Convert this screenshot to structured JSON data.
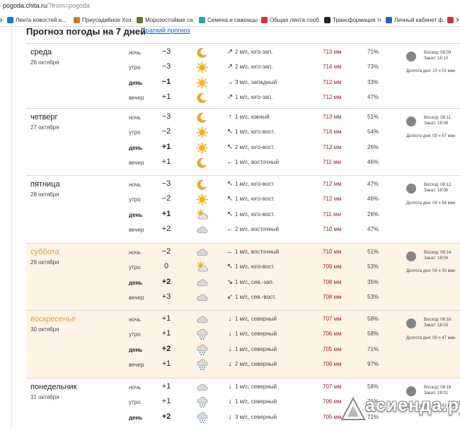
{
  "browser": {
    "url_host": "pogoda.chita.ru",
    "url_path": "/?from=pogoda"
  },
  "bookmarks": [
    {
      "label": "Лента новостей и...",
      "color": "#1a73e8"
    },
    {
      "label": "Приусадебное Хоз...",
      "color": "#c77a20"
    },
    {
      "label": "Морозостойкие са...",
      "color": "#5a7a30"
    },
    {
      "label": "Семена и саженцы...",
      "color": "#2aa8a0"
    },
    {
      "label": "Общая лента сооб...",
      "color": "#d9342b"
    },
    {
      "label": "Трансформация те...",
      "color": "#222222"
    },
    {
      "label": "Личный кабинет ф...",
      "color": "#2f5bd0"
    },
    {
      "label": "У",
      "color": "#d9342b"
    }
  ],
  "header": {
    "title": "Прогноз погоды на 7 дней",
    "short_link": "краткий прогноз"
  },
  "days": [
    {
      "name": "среда",
      "date": "26 октября",
      "weekend": false,
      "sunrise": "Восход: 08:09",
      "sunset": "Закат: 18:10",
      "daylen": "Долгота дня: 10 ч 01 мин",
      "rows": [
        {
          "part": "ночь",
          "bold": false,
          "temp": "−3",
          "icon": "moon",
          "dir": "↗",
          "wind": "2 м/с, юго-зап.",
          "press": "713 мм",
          "hum": "71%"
        },
        {
          "part": "утро",
          "bold": false,
          "temp": "−3",
          "icon": "sun",
          "dir": "↗",
          "wind": "2 м/с, юго-зап.",
          "press": "714 мм",
          "hum": "73%"
        },
        {
          "part": "день",
          "bold": true,
          "temp": "−1",
          "icon": "sun",
          "dir": "→",
          "wind": "3 м/с, западный",
          "press": "712 мм",
          "hum": "33%"
        },
        {
          "part": "вечер",
          "bold": false,
          "temp": "+1",
          "icon": "moon",
          "dir": "↗",
          "wind": "1 м/с, юго-зап.",
          "press": "712 мм",
          "hum": "47%"
        }
      ]
    },
    {
      "name": "четверг",
      "date": "27 октября",
      "weekend": false,
      "sunrise": "Восход: 08:11",
      "sunset": "Закат: 18:08",
      "daylen": "Долгота дня: 09 ч 57 мин",
      "rows": [
        {
          "part": "ночь",
          "bold": false,
          "temp": "−3",
          "icon": "moon",
          "dir": "↑",
          "wind": "1 м/с, южный",
          "press": "713 мм",
          "hum": "51%"
        },
        {
          "part": "утро",
          "bold": false,
          "temp": "−2",
          "icon": "sun",
          "dir": "↖",
          "wind": "1 м/с, юго-вост.",
          "press": "714 мм",
          "hum": "54%"
        },
        {
          "part": "день",
          "bold": true,
          "temp": "+1",
          "icon": "sun",
          "dir": "↖",
          "wind": "2 м/с, юго-вост.",
          "press": "712 мм",
          "hum": "26%"
        },
        {
          "part": "вечер",
          "bold": false,
          "temp": "+1",
          "icon": "moon",
          "dir": "←",
          "wind": "1 м/с, восточный",
          "press": "711 мм",
          "hum": "46%"
        }
      ]
    },
    {
      "name": "пятница",
      "date": "28 октября",
      "weekend": false,
      "sunrise": "Восход: 08:12",
      "sunset": "Закат: 18:06",
      "daylen": "Долгота дня: 09 ч 54 мин",
      "rows": [
        {
          "part": "ночь",
          "bold": false,
          "temp": "−3",
          "icon": "moon",
          "dir": "↖",
          "wind": "1 м/с, юго-вост.",
          "press": "712 мм",
          "hum": "47%"
        },
        {
          "part": "утро",
          "bold": false,
          "temp": "−2",
          "icon": "sun",
          "dir": "↖",
          "wind": "1 м/с, юго-вост.",
          "press": "712 мм",
          "hum": "46%"
        },
        {
          "part": "день",
          "bold": true,
          "temp": "+1",
          "icon": "suncloud",
          "dir": "↖",
          "wind": "1 м/с, юго-вост.",
          "press": "711 мм",
          "hum": "26%"
        },
        {
          "part": "вечер",
          "bold": false,
          "temp": "+2",
          "icon": "cloud",
          "dir": "←",
          "wind": "2 м/с, восточный",
          "press": "710 мм",
          "hum": "47%"
        }
      ]
    },
    {
      "name": "суббота",
      "date": "29 октября",
      "weekend": true,
      "sunrise": "Восход: 08:14",
      "sunset": "Закат: 18:04",
      "daylen": "Долгота дня: 09 ч 50 мин",
      "rows": [
        {
          "part": "ночь",
          "bold": false,
          "temp": "−2",
          "icon": "cloud",
          "dir": "←",
          "wind": "1 м/с, восточный",
          "press": "710 мм",
          "hum": "51%"
        },
        {
          "part": "утро",
          "bold": false,
          "temp": "0",
          "icon": "suncloud",
          "dir": "↖",
          "wind": "1 м/с, юго-вост.",
          "press": "709 мм",
          "hum": "53%"
        },
        {
          "part": "день",
          "bold": true,
          "temp": "+2",
          "icon": "cloud",
          "dir": "↘",
          "wind": "1 м/с, сев.-зап.",
          "press": "708 мм",
          "hum": "35%"
        },
        {
          "part": "вечер",
          "bold": false,
          "temp": "+3",
          "icon": "cloud",
          "dir": "↙",
          "wind": "1 м/с, сев.-вост.",
          "press": "708 мм",
          "hum": "53%"
        }
      ]
    },
    {
      "name": "воскресенье",
      "date": "30 октября",
      "weekend": true,
      "sunrise": "Восход: 08:16",
      "sunset": "Закат: 18:03",
      "daylen": "Долгота дня: 09 ч 47 мин",
      "rows": [
        {
          "part": "ночь",
          "bold": false,
          "temp": "+1",
          "icon": "cloud",
          "dir": "↓",
          "wind": "1 м/с, северный",
          "press": "707 мм",
          "hum": "58%"
        },
        {
          "part": "утро",
          "bold": false,
          "temp": "+1",
          "icon": "snow",
          "dir": "↓",
          "wind": "1 м/с, северный",
          "press": "706 мм",
          "hum": "58%"
        },
        {
          "part": "день",
          "bold": true,
          "temp": "+2",
          "icon": "snow",
          "dir": "↓",
          "wind": "1 м/с, северный",
          "press": "705 мм",
          "hum": "71%"
        },
        {
          "part": "вечер",
          "bold": false,
          "temp": "+1",
          "icon": "snow",
          "dir": "↓",
          "wind": "2 м/с, северный",
          "press": "706 мм",
          "hum": "97%"
        }
      ]
    },
    {
      "name": "понедельник",
      "date": "31 октября",
      "weekend": false,
      "sunrise": "Восход: 08:18",
      "sunset": "Закат: 18:01",
      "daylen": "Долгота дня: 09 ч 43 мин",
      "rows": [
        {
          "part": "ночь",
          "bold": false,
          "temp": "+1",
          "icon": "cloud",
          "dir": "↓",
          "wind": "1 м/с, северный",
          "press": "707 мм",
          "hum": "58%"
        },
        {
          "part": "утро",
          "bold": false,
          "temp": "+1",
          "icon": "snow",
          "dir": "↓",
          "wind": "1 м/с, северный",
          "press": "706 мм",
          "hum": "71%"
        },
        {
          "part": "день",
          "bold": true,
          "temp": "+2",
          "icon": "snow",
          "dir": "↓",
          "wind": "3 м/с, северный",
          "press": "705 мм",
          "hum": "71%"
        }
      ]
    }
  ],
  "watermark": {
    "text": "асиенда.ру"
  },
  "colors": {
    "weekend_bg": "#fdf4e6",
    "weekend_name": "#e8a030",
    "pressure": "#b01a1a",
    "link": "#1a5cc8"
  }
}
